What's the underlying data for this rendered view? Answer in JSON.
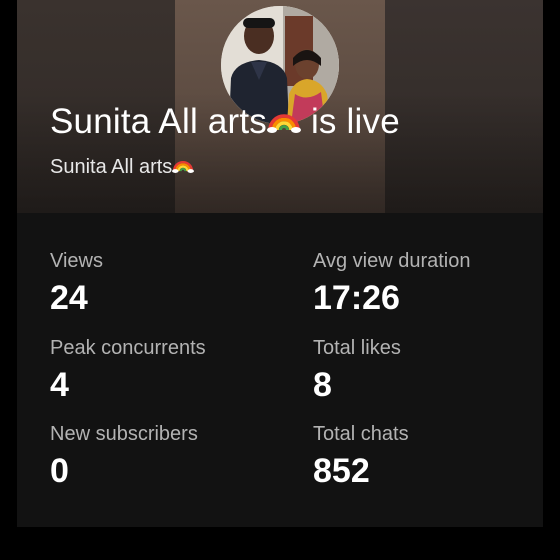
{
  "header": {
    "channel_name": "Sunita All arts",
    "live_suffix": "is live",
    "rainbow_icon": "rainbow-emoji",
    "avatar_icon": "channel-avatar-photo"
  },
  "stats": [
    {
      "label": "Views",
      "value": "24"
    },
    {
      "label": "Avg view duration",
      "value": "17:26"
    },
    {
      "label": "Peak concurrents",
      "value": "4"
    },
    {
      "label": "Total likes",
      "value": "8"
    },
    {
      "label": "New subscribers",
      "value": "0"
    },
    {
      "label": "Total chats",
      "value": "852"
    }
  ],
  "colors": {
    "background": "#000000",
    "card": "#121212",
    "label": "#b3b3b3",
    "value": "#ffffff"
  }
}
